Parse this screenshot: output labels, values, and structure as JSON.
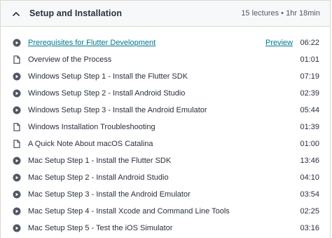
{
  "section": {
    "title": "Setup and Installation",
    "meta": "15 lectures • 1hr 18min",
    "expanded_icon": "chevron-up-icon"
  },
  "lectures": [
    {
      "title": "Prerequisites for Flutter Development",
      "duration": "06:22",
      "type": "video",
      "preview": "Preview"
    },
    {
      "title": "Overview of the Process",
      "duration": "01:01",
      "type": "article"
    },
    {
      "title": "Windows Setup Step 1 - Install the Flutter SDK",
      "duration": "07:19",
      "type": "video"
    },
    {
      "title": "Windows Setup Step 2 - Install Android Studio",
      "duration": "02:39",
      "type": "video"
    },
    {
      "title": "Windows Setup Step 3 - Install the Android Emulator",
      "duration": "05:44",
      "type": "video"
    },
    {
      "title": "Windows Installation Troubleshooting",
      "duration": "01:39",
      "type": "article"
    },
    {
      "title": "A Quick Note About macOS Catalina",
      "duration": "01:00",
      "type": "article"
    },
    {
      "title": "Mac Setup Step 1 - Install the Flutter SDK",
      "duration": "13:46",
      "type": "video"
    },
    {
      "title": "Mac Setup Step 2 - Install Android Studio",
      "duration": "04:10",
      "type": "video"
    },
    {
      "title": "Mac Setup Step 3 - Install the Android Emulator",
      "duration": "03:54",
      "type": "video"
    },
    {
      "title": "Mac Setup Step 4 - Install Xcode and Command Line Tools",
      "duration": "02:25",
      "type": "video"
    },
    {
      "title": "Mac Setup Step 5 - Test the iOS Simulator",
      "duration": "03:16",
      "type": "video"
    }
  ],
  "colors": {
    "link": "#007791",
    "text": "#29303b",
    "icon": "#505763",
    "header_bg": "#f7f8fa",
    "border": "#dcdacb"
  }
}
